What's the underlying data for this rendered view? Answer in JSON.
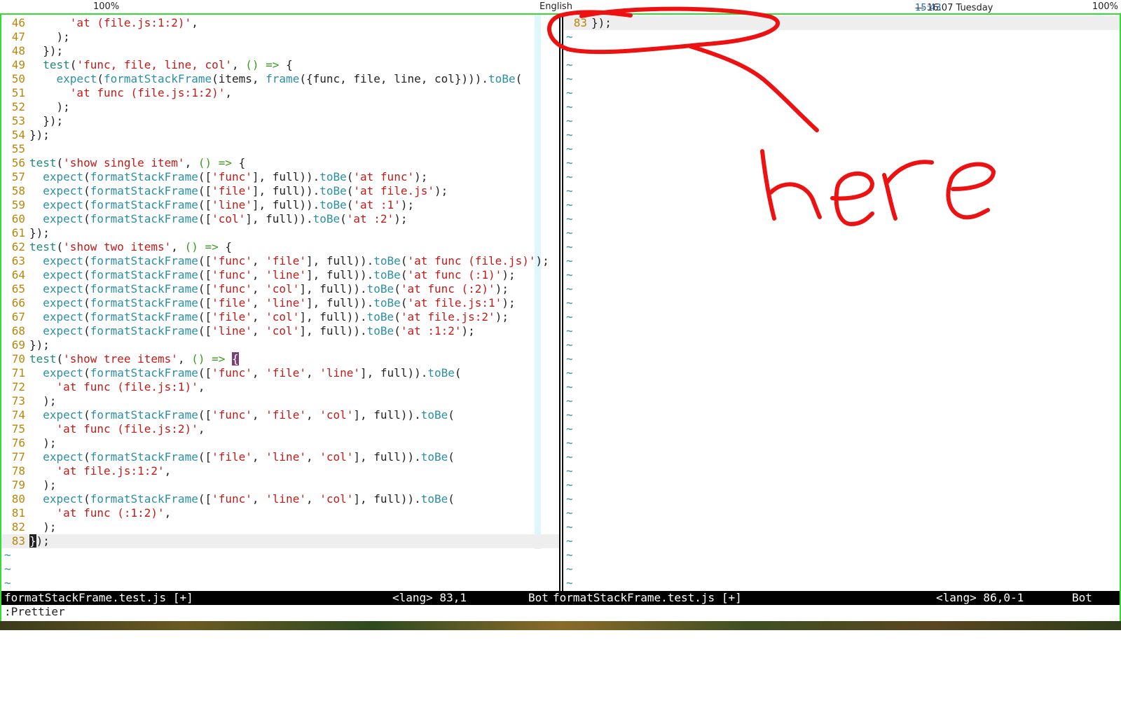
{
  "topbar": {
    "left_percent": "100%",
    "language": "English",
    "clock_time": "15:43",
    "clock_date": " — 16.07 Tuesday",
    "right_percent": "100%"
  },
  "editor_left": {
    "lines": [
      {
        "n": "46",
        "code": "      'at (file.js:1:2)',"
      },
      {
        "n": "47",
        "code": "    );"
      },
      {
        "n": "48",
        "code": "  });"
      },
      {
        "n": "49",
        "code": "  test('func, file, line, col', () => {"
      },
      {
        "n": "50",
        "code": "    expect(formatStackFrame(items, frame({func, file, line, col}))).toBe("
      },
      {
        "n": "51",
        "code": "      'at func (file.js:1:2)',"
      },
      {
        "n": "52",
        "code": "    );"
      },
      {
        "n": "53",
        "code": "  });"
      },
      {
        "n": "54",
        "code": "});"
      },
      {
        "n": "55",
        "code": ""
      },
      {
        "n": "56",
        "code": "test('show single item', () => {"
      },
      {
        "n": "57",
        "code": "  expect(formatStackFrame(['func'], full)).toBe('at func');"
      },
      {
        "n": "58",
        "code": "  expect(formatStackFrame(['file'], full)).toBe('at file.js');"
      },
      {
        "n": "59",
        "code": "  expect(formatStackFrame(['line'], full)).toBe('at :1');"
      },
      {
        "n": "60",
        "code": "  expect(formatStackFrame(['col'], full)).toBe('at :2');"
      },
      {
        "n": "61",
        "code": "});"
      },
      {
        "n": "62",
        "code": "test('show two items', () => {"
      },
      {
        "n": "63",
        "code": "  expect(formatStackFrame(['func', 'file'], full)).toBe('at func (file.js)');"
      },
      {
        "n": "64",
        "code": "  expect(formatStackFrame(['func', 'line'], full)).toBe('at func (:1)');"
      },
      {
        "n": "65",
        "code": "  expect(formatStackFrame(['func', 'col'], full)).toBe('at func (:2)');"
      },
      {
        "n": "66",
        "code": "  expect(formatStackFrame(['file', 'line'], full)).toBe('at file.js:1');"
      },
      {
        "n": "67",
        "code": "  expect(formatStackFrame(['file', 'col'], full)).toBe('at file.js:2');"
      },
      {
        "n": "68",
        "code": "  expect(formatStackFrame(['line', 'col'], full)).toBe('at :1:2');"
      },
      {
        "n": "69",
        "code": "});"
      },
      {
        "n": "70",
        "code": "test('show tree items', () => {"
      },
      {
        "n": "71",
        "code": "  expect(formatStackFrame(['func', 'file', 'line'], full)).toBe("
      },
      {
        "n": "72",
        "code": "    'at func (file.js:1)',"
      },
      {
        "n": "73",
        "code": "  );"
      },
      {
        "n": "74",
        "code": "  expect(formatStackFrame(['func', 'file', 'col'], full)).toBe("
      },
      {
        "n": "75",
        "code": "    'at func (file.js:2)',"
      },
      {
        "n": "76",
        "code": "  );"
      },
      {
        "n": "77",
        "code": "  expect(formatStackFrame(['file', 'line', 'col'], full)).toBe("
      },
      {
        "n": "78",
        "code": "    'at file.js:1:2',"
      },
      {
        "n": "79",
        "code": "  );"
      },
      {
        "n": "80",
        "code": "  expect(formatStackFrame(['func', 'line', 'col'], full)).toBe("
      },
      {
        "n": "81",
        "code": "    'at func (:1:2)',"
      },
      {
        "n": "82",
        "code": "  );"
      },
      {
        "n": "83",
        "code": "});"
      }
    ],
    "tilde_count": 3
  },
  "editor_right": {
    "lines": [
      {
        "n": "83",
        "code": "});"
      }
    ],
    "tilde_count": 40
  },
  "status_left": {
    "filename": "formatStackFrame.test.js [+]",
    "lang": "<lang> 83,1",
    "pos": "Bot"
  },
  "status_right": {
    "filename": "formatStackFrame.test.js [+]",
    "lang": "<lang> 86,0-1",
    "pos": "Bot"
  },
  "cmdline": ":Prettier",
  "annotation": {
    "text": "here",
    "color": "#ee1111"
  }
}
